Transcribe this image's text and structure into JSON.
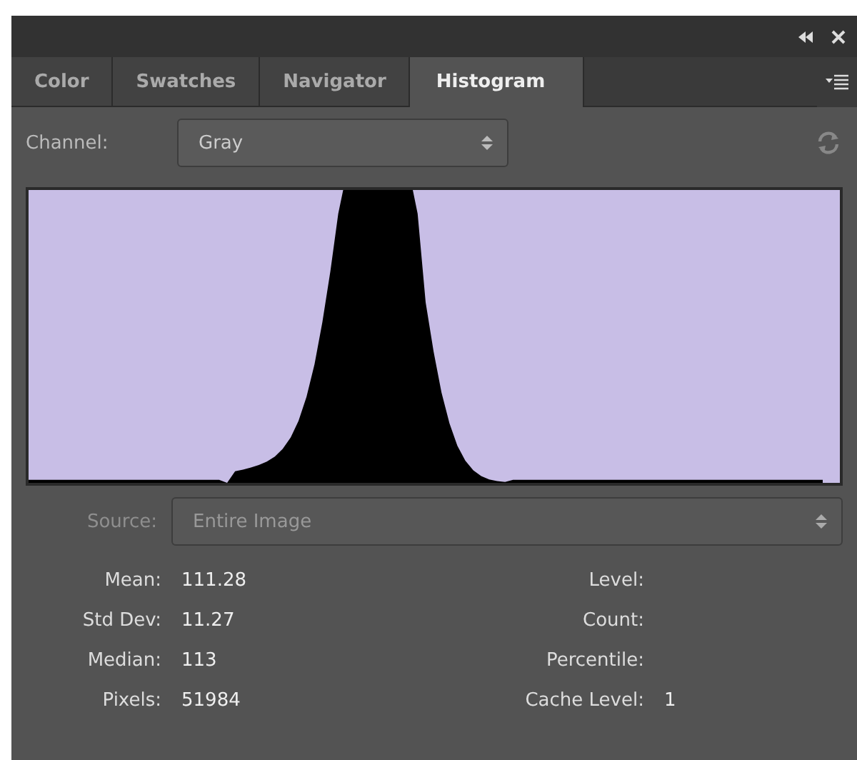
{
  "tabs": [
    {
      "label": "Color",
      "selected": false
    },
    {
      "label": "Swatches",
      "selected": false
    },
    {
      "label": "Navigator",
      "selected": false
    },
    {
      "label": "Histogram",
      "selected": true
    }
  ],
  "channel": {
    "label": "Channel:",
    "value": "Gray"
  },
  "source": {
    "label": "Source:",
    "value": "Entire Image",
    "disabled": true
  },
  "stats_left": [
    {
      "label": "Mean:",
      "value": "111.28"
    },
    {
      "label": "Std Dev:",
      "value": "11.27"
    },
    {
      "label": "Median:",
      "value": "113"
    },
    {
      "label": "Pixels:",
      "value": "51984"
    }
  ],
  "stats_right": [
    {
      "label": "Level:"
    },
    {
      "label": "Count:"
    },
    {
      "label": "Percentile:"
    },
    {
      "label": "Cache Level:",
      "value": "1"
    }
  ]
}
